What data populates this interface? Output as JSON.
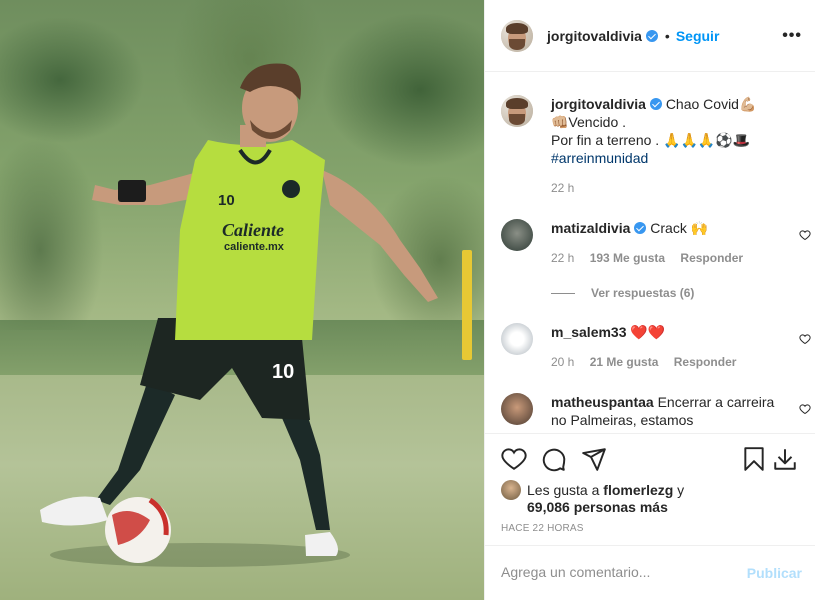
{
  "post": {
    "image_alt": "Jugador con chaleco verde número 10 controlando un balón en el campo de entrenamiento"
  },
  "header": {
    "username": "jorgitovaldivia",
    "dot": "•",
    "follow_label": "Seguir",
    "more_label": "•••"
  },
  "caption": {
    "username": "jorgitovaldivia",
    "text_line1": "Chao Covid💪🏼",
    "text_line2": "👊🏼Vencido .",
    "text_line3": "Por fin a terreno . 🙏🙏🙏⚽🎩",
    "hashtag": "#arreinmunidad",
    "time": "22 h"
  },
  "comments": [
    {
      "username": "matizaldivia",
      "verified": true,
      "text": "Crack 🙌",
      "time": "22 h",
      "likes": "193 Me gusta",
      "reply_label": "Responder"
    },
    {
      "username": "m_salem33",
      "verified": false,
      "text": "❤️❤️",
      "time": "20 h",
      "likes": "21 Me gusta",
      "reply_label": "Responder"
    },
    {
      "username": "matheuspantaa",
      "verified": false,
      "text": "Encerrar a carreira no Palmeiras, estamos"
    }
  ],
  "view_replies": "Ver respuestas (6)",
  "likes": {
    "prefix": "Les gusta a ",
    "user": "flomerlezg",
    "suffix": " y",
    "count_line": "69,086 personas más"
  },
  "timestamp": "HACE 22 HORAS",
  "add_comment": {
    "placeholder": "Agrega un comentario...",
    "post_label": "Publicar"
  },
  "colors": {
    "link_blue": "#0095f6",
    "verified_blue": "#3897f0",
    "hashtag": "#00376b",
    "muted": "#8e8e8e",
    "post_disabled": "#b2dffc"
  }
}
